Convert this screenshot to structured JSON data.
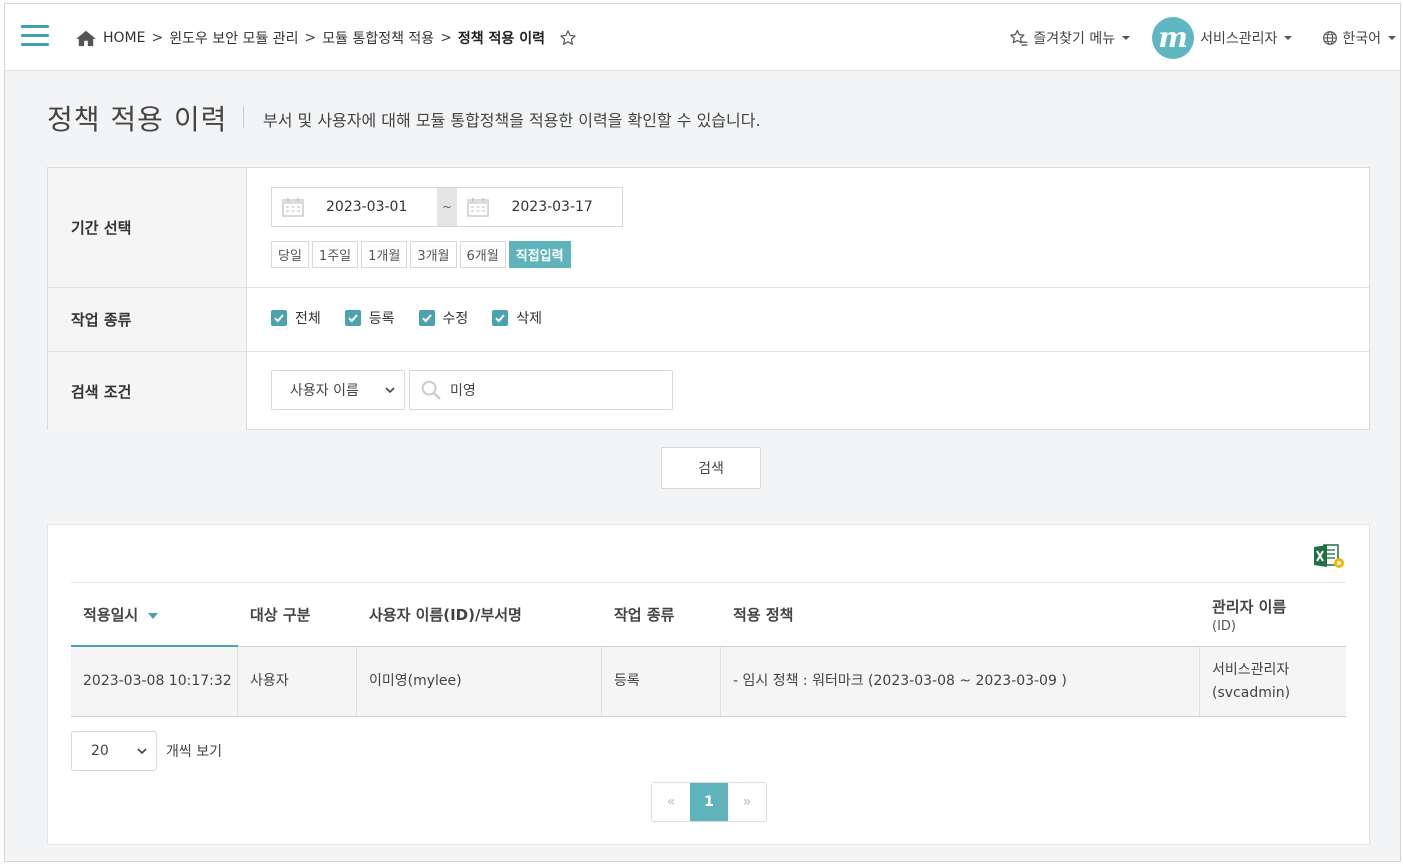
{
  "header": {
    "breadcrumb": {
      "home": "HOME",
      "sep": ">",
      "items": [
        "윈도우 보안 모듈 관리",
        "모듈 통합정책 적용"
      ],
      "current": "정책 적용 이력"
    },
    "favorites_label": "즐겨찾기 메뉴",
    "avatar_letter": "m",
    "user_label": "서비스관리자",
    "language_label": "한국어"
  },
  "page": {
    "title": "정책 적용 이력",
    "description": "부서 및 사용자에 대해 모듈 통합정책을 적용한 이력을 확인할 수 있습니다."
  },
  "search": {
    "period_label": "기간 선택",
    "start_date": "2023-03-01",
    "tilde": "~",
    "end_date": "2023-03-17",
    "presets": [
      "당일",
      "1주일",
      "1개월",
      "3개월",
      "6개월",
      "직접입력"
    ],
    "active_preset": "직접입력",
    "worktype_label": "작업 종류",
    "checks": [
      {
        "label": "전체",
        "checked": true
      },
      {
        "label": "등록",
        "checked": true
      },
      {
        "label": "수정",
        "checked": true
      },
      {
        "label": "삭제",
        "checked": true
      }
    ],
    "condition_label": "검색 조건",
    "condition_select": "사용자 이름",
    "keyword": "미영",
    "button": "검색"
  },
  "table": {
    "columns": [
      {
        "label": "적용일시",
        "sub": ""
      },
      {
        "label": "대상 구분",
        "sub": ""
      },
      {
        "label": "사용자 이름(ID)/부서명",
        "sub": ""
      },
      {
        "label": "작업 종류",
        "sub": ""
      },
      {
        "label": "적용 정책",
        "sub": ""
      },
      {
        "label": "관리자 이름",
        "sub": "(ID)"
      }
    ],
    "rows": [
      {
        "date": "2023-03-08 10:17:32",
        "target": "사용자",
        "user": "이미영(mylee)",
        "work": "등록",
        "policy": "- 임시 정책 : 워터마크 (2023-03-08 ~ 2023-03-09 )",
        "admin_name": "서비스관리자",
        "admin_id": "(svcadmin)"
      }
    ]
  },
  "pagination": {
    "page_size": "20",
    "page_size_label": "개씩 보기",
    "prev": "«",
    "current": "1",
    "next": "»"
  },
  "colors": {
    "accent": "#5fb3bb",
    "checkbox": "#4aa3ae",
    "excel": "#1e7145"
  }
}
